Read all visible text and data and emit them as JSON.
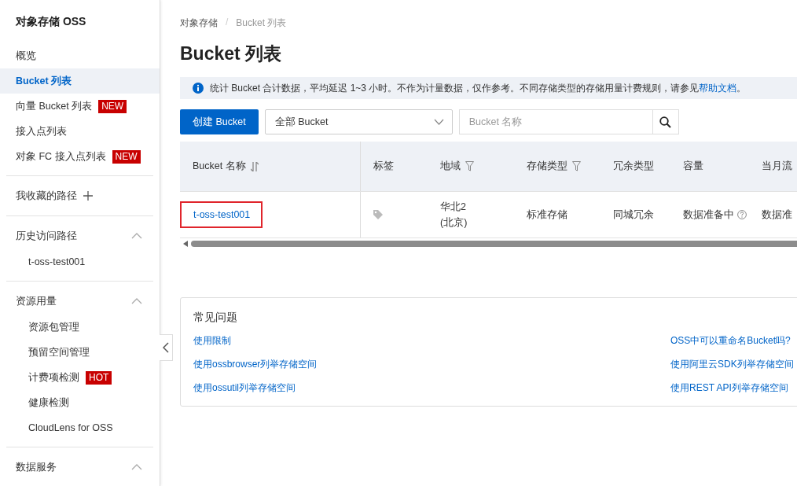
{
  "sidebar": {
    "title": "对象存储 OSS",
    "nav": [
      {
        "label": "概览",
        "selected": false
      },
      {
        "label": "Bucket 列表",
        "selected": true
      },
      {
        "label": "向量 Bucket 列表",
        "selected": false,
        "badge": "NEW"
      },
      {
        "label": "接入点列表",
        "selected": false
      },
      {
        "label": "对象 FC 接入点列表",
        "selected": false,
        "badge": "NEW"
      }
    ],
    "favorites": {
      "label": "我收藏的路径"
    },
    "sections": [
      {
        "title": "历史访问路径",
        "expanded": true,
        "children": [
          {
            "label": "t-oss-test001"
          }
        ]
      },
      {
        "title": "资源用量",
        "expanded": true,
        "children": [
          {
            "label": "资源包管理"
          },
          {
            "label": "预留空间管理"
          },
          {
            "label": "计费项检测",
            "badge": "HOT"
          },
          {
            "label": "健康检测"
          },
          {
            "label": "CloudLens for OSS"
          }
        ]
      },
      {
        "title": "数据服务",
        "expanded": true
      }
    ]
  },
  "breadcrumb": [
    "对象存储",
    "Bucket 列表"
  ],
  "breadcrumb_separator": "/",
  "page_title": "Bucket 列表",
  "info": {
    "text": "统计 Bucket 合计数据，平均延迟 1~3 小时。不作为计量数据，仅作参考。不同存储类型的存储用量计费规则，请参见",
    "link": "帮助文档",
    "suffix": "。"
  },
  "toolbar": {
    "create_button": "创建 Bucket",
    "filter_select": "全部 Bucket",
    "search": {
      "placeholder": "Bucket 名称"
    }
  },
  "table": {
    "columns": [
      {
        "label": "Bucket 名称",
        "sortable": true,
        "filterable": false
      },
      {
        "label": "标签",
        "sortable": false,
        "filterable": false
      },
      {
        "label": "地域",
        "sortable": false,
        "filterable": true
      },
      {
        "label": "存储类型",
        "sortable": false,
        "filterable": true
      },
      {
        "label": "冗余类型",
        "sortable": false,
        "filterable": false
      },
      {
        "label": "容量",
        "sortable": false,
        "filterable": false
      },
      {
        "label": "当月流"
      }
    ],
    "rows": [
      {
        "cells": [
          {
            "kind": "link",
            "text": "t-oss-test001",
            "outlined": true
          },
          {
            "kind": "tag"
          },
          {
            "kind": "text",
            "text": "华北2\n(北京)"
          },
          {
            "kind": "text",
            "text": "标准存储"
          },
          {
            "kind": "text",
            "text": "同城冗余"
          },
          {
            "kind": "help",
            "text": "数据准备中"
          },
          {
            "kind": "text",
            "text": "数据准"
          }
        ]
      }
    ]
  },
  "faq": {
    "title": "常见问题",
    "left": [
      "使用限制",
      "使用ossbrowser列举存储空间",
      "使用ossutil列举存储空间"
    ],
    "right": [
      "OSS中可以重命名Bucket吗?",
      "使用阿里云SDK列举存储空间",
      "使用REST API列举存储空间"
    ]
  }
}
